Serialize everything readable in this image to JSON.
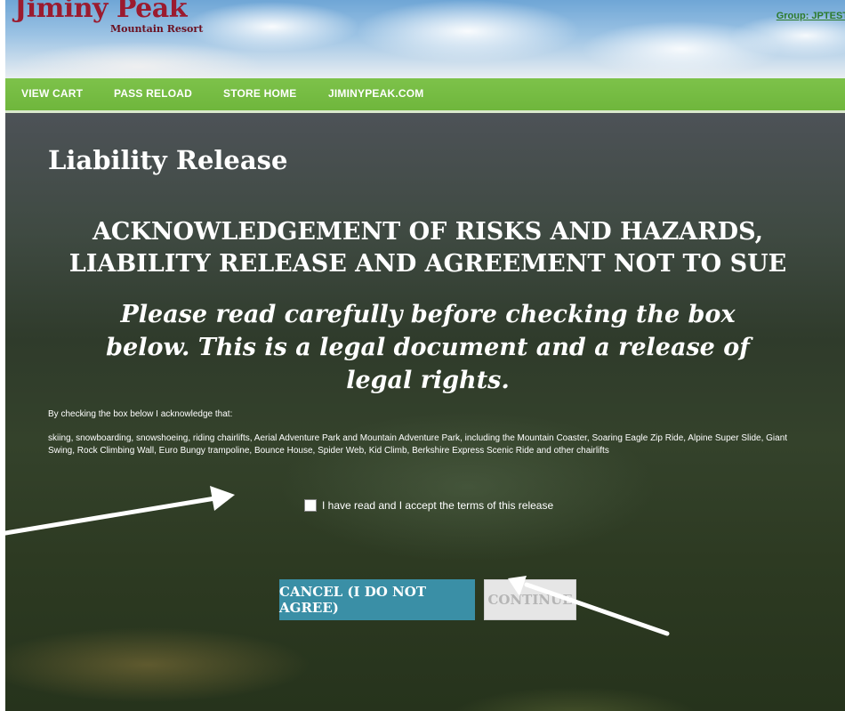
{
  "header": {
    "logo_text": "Jiminy Peak",
    "logo_sub": "Mountain Resort",
    "group_link": "Group: JPTEST"
  },
  "nav": {
    "items": [
      "VIEW CART",
      "PASS RELOAD",
      "STORE HOME",
      "JIMINYPEAK.COM"
    ]
  },
  "main": {
    "title": "Liability Release",
    "heading_line1": "ACKNOWLEDGEMENT OF RISKS AND HAZARDS,",
    "heading_line2": "LIABILITY RELEASE AND AGREEMENT NOT TO SUE",
    "subheading_line1": "Please read carefully before checking the box",
    "subheading_line2": "below. This is a legal document and a release of",
    "subheading_line3": "legal rights.",
    "intro": "By checking the box below I acknowledge that:",
    "terms": "skiing, snowboarding, snowshoeing, riding chairlifts, Aerial Adventure Park and Mountain Adventure Park, including the Mountain Coaster, Soaring Eagle Zip Ride, Alpine Super Slide, Giant Swing, Rock Climbing Wall, Euro Bungy trampoline, Bounce House, Spider Web, Kid Climb, Berkshire Express Scenic Ride and other chairlifts",
    "accept_label": "I have read and I accept the terms of this release",
    "accept_checked": false,
    "cancel_label": "CANCEL (I DO NOT AGREE)",
    "continue_label": "CONTINUE"
  },
  "colors": {
    "nav_green": "#72b840",
    "cancel_teal": "#3a8fa6",
    "logo_red": "#9b1b2f"
  }
}
